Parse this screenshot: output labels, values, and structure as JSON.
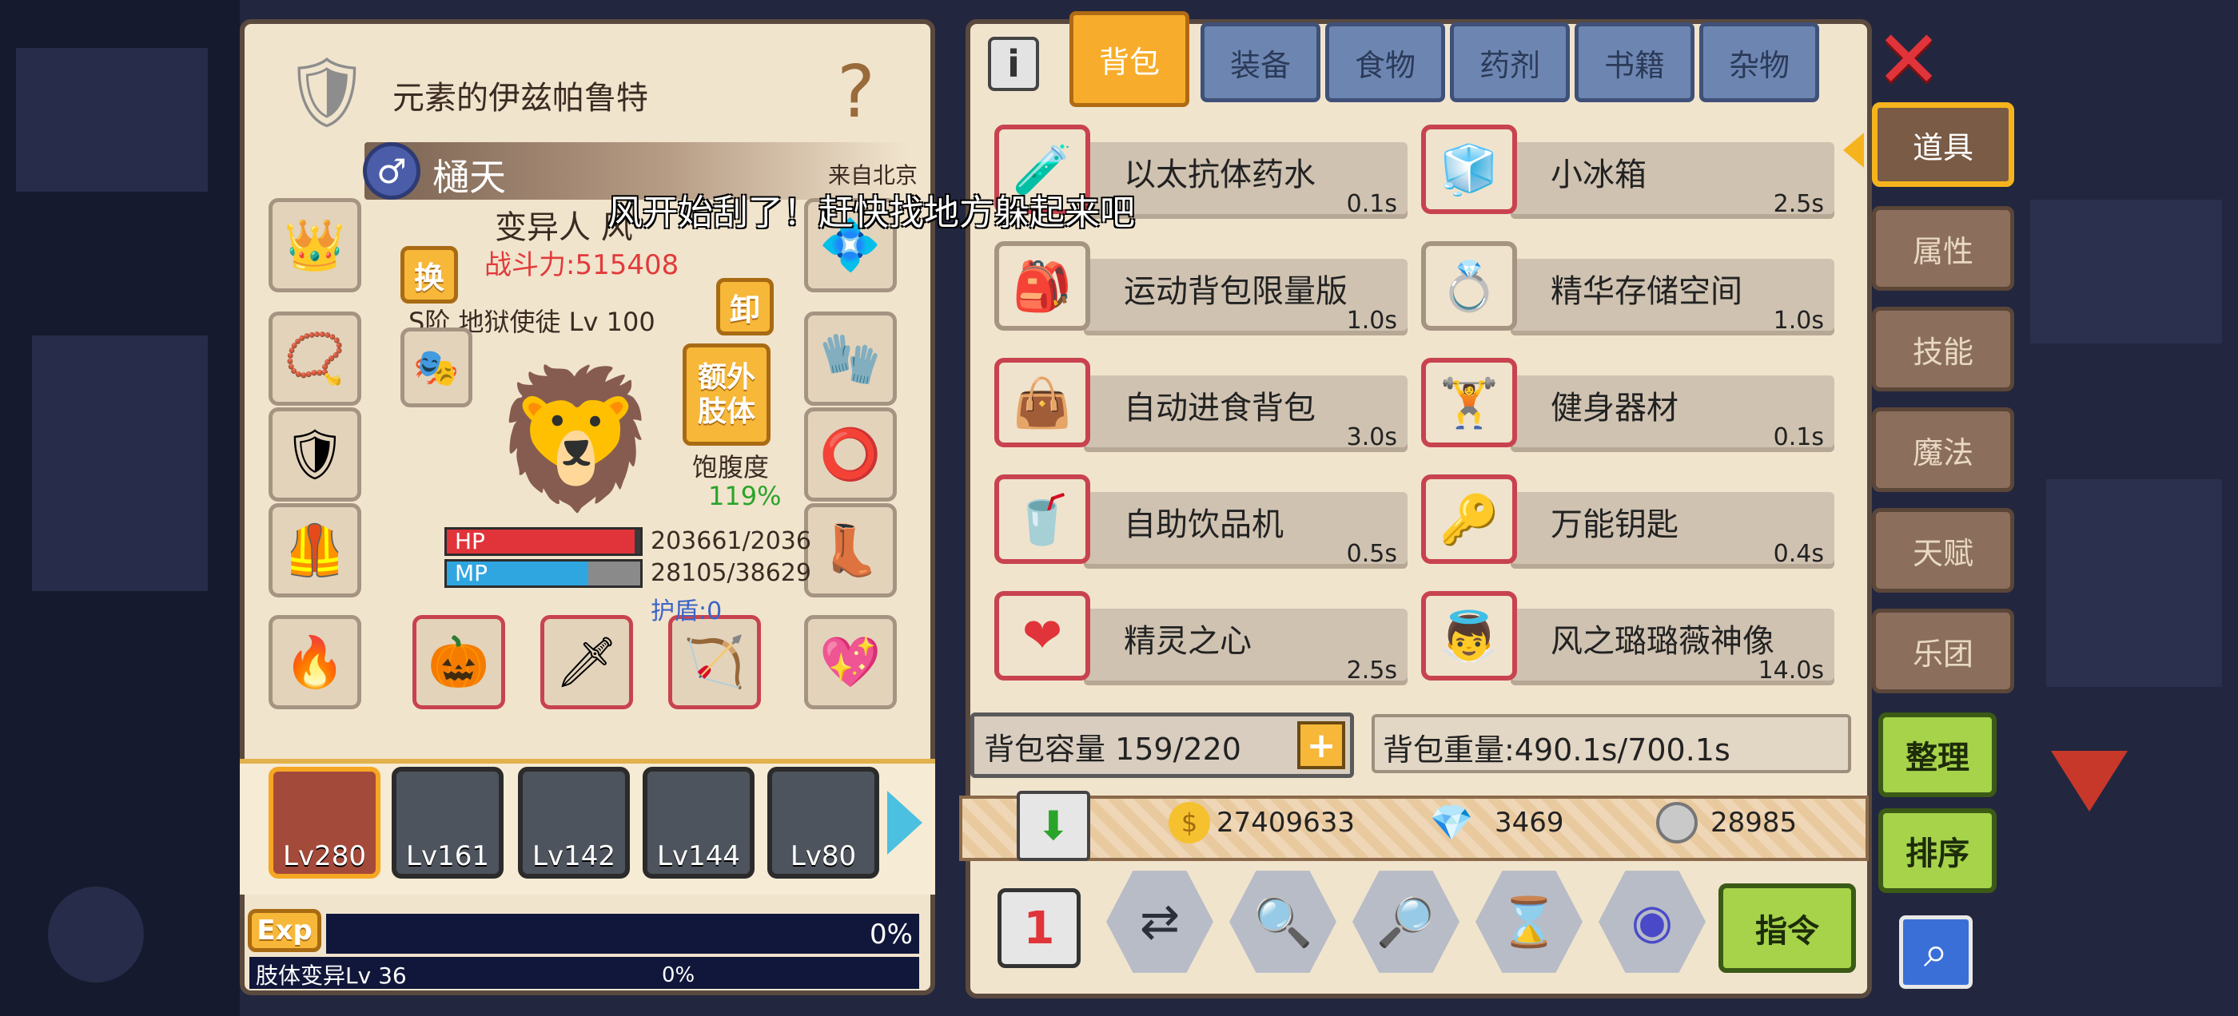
{
  "character": {
    "title": "元素的伊兹帕鲁特",
    "name": "樋天",
    "gender_symbol": "♂",
    "origin": "来自北京",
    "race": "变异人",
    "race_cut": "风",
    "power": "战斗力:515408",
    "rank": "S阶 地狱使徒 Lv 100",
    "swap_label": "换",
    "unequip_label": "卸",
    "extra_limb_label": "额外肢体",
    "satiety_label": "饱腹度",
    "satiety_value": "119%",
    "hp_label": "HP",
    "hp_value": "203661/2036",
    "hp_fill": 0.97,
    "mp_label": "MP",
    "mp_value": "28105/38629",
    "mp_fill": 0.73,
    "shield": "护盾:0",
    "exp_label": "Exp",
    "exp_value": "0%",
    "mutation_label": "肢体变异Lv 36",
    "mutation_value": "0%",
    "party": [
      "Lv280",
      "Lv161",
      "Lv142",
      "Lv144",
      "Lv80"
    ]
  },
  "subtitle_text": "风开始刮了！赶快找地方躲起来吧",
  "tabs": [
    "背包",
    "装备",
    "食物",
    "药剂",
    "书籍",
    "杂物"
  ],
  "items": [
    {
      "name": "以太抗体药水",
      "time": "0.1s",
      "icon": "🧪"
    },
    {
      "name": "小冰箱",
      "time": "2.5s",
      "icon": "🧊"
    },
    {
      "name": "运动背包限量版",
      "time": "1.0s",
      "icon": "🎒"
    },
    {
      "name": "精华存储空间",
      "time": "1.0s",
      "icon": "💍"
    },
    {
      "name": "自动进食背包",
      "time": "3.0s",
      "icon": "👜"
    },
    {
      "name": "健身器材",
      "time": "0.1s",
      "icon": "🏋"
    },
    {
      "name": "自助饮品机",
      "time": "0.5s",
      "icon": "🥤"
    },
    {
      "name": "万能钥匙",
      "time": "0.4s",
      "icon": "🔑"
    },
    {
      "name": "精灵之心",
      "time": "2.5s",
      "icon": "❤"
    },
    {
      "name": "风之璐璐薇神像",
      "time": "14.0s",
      "icon": "👼"
    }
  ],
  "capacity": "背包容量 159/220",
  "weight": "背包重量:490.1s/700.1s",
  "currency": {
    "gold": "27409633",
    "diamond": "3469",
    "silver": "28985"
  },
  "side_tabs": [
    "道具",
    "属性",
    "技能",
    "魔法",
    "天赋",
    "乐团"
  ],
  "buttons": {
    "sort": "整理",
    "order": "排序",
    "command": "指令"
  },
  "colors": {
    "accent": "#f7ad2b",
    "tab": "#6d86b1",
    "close": "#e0343a",
    "green": "#a6d34a"
  }
}
